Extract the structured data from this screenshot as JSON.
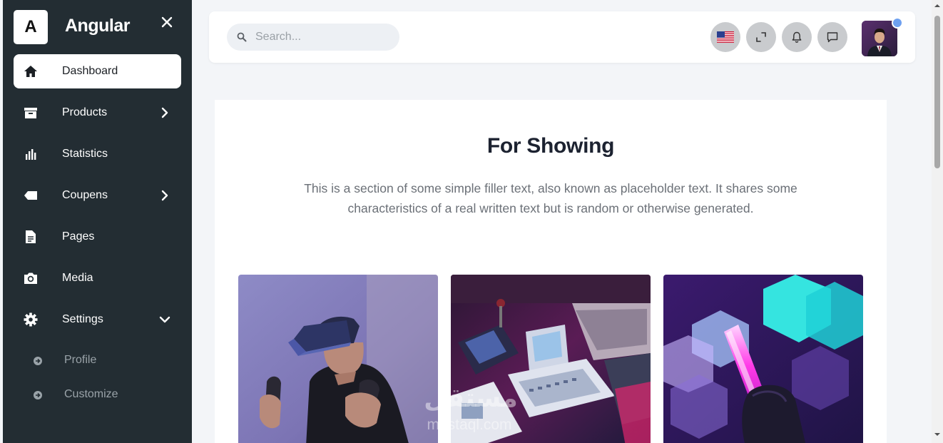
{
  "brand": {
    "logo_letter": "A",
    "name": "Angular"
  },
  "sidebar": {
    "items": [
      {
        "label": "Dashboard",
        "icon": "home-icon"
      },
      {
        "label": "Products",
        "icon": "archive-icon"
      },
      {
        "label": "Statistics",
        "icon": "bar-chart-icon"
      },
      {
        "label": "Coupens",
        "icon": "tag-icon"
      },
      {
        "label": "Pages",
        "icon": "document-icon"
      },
      {
        "label": "Media",
        "icon": "camera-icon"
      },
      {
        "label": "Settings",
        "icon": "gear-icon"
      }
    ],
    "settings_sub": [
      {
        "label": "Profile",
        "icon": "arrow-circle-icon"
      },
      {
        "label": "Customize",
        "icon": "arrow-circle-icon"
      }
    ],
    "active_item": "Dashboard"
  },
  "topbar": {
    "search_placeholder": "Search...",
    "buttons": [
      "us-flag-icon",
      "fullscreen-icon",
      "bell-icon",
      "chat-icon"
    ]
  },
  "main": {
    "title": "For Showing",
    "description": "This is a section of some simple filler text, also known as placeholder text. It shares some characteristics of a real written text but is random or otherwise generated.",
    "gallery": [
      "vr-headset-photo",
      "retro-computers-photo",
      "neon-light-photo"
    ]
  },
  "watermark": {
    "arabic": "مستقل",
    "latin": "mostaql.com"
  },
  "colors": {
    "sidebar_bg": "#232d33",
    "page_bg": "#f3f5f8",
    "active_item_bg": "#ffffff",
    "submenu_text": "#9aa3a9"
  }
}
